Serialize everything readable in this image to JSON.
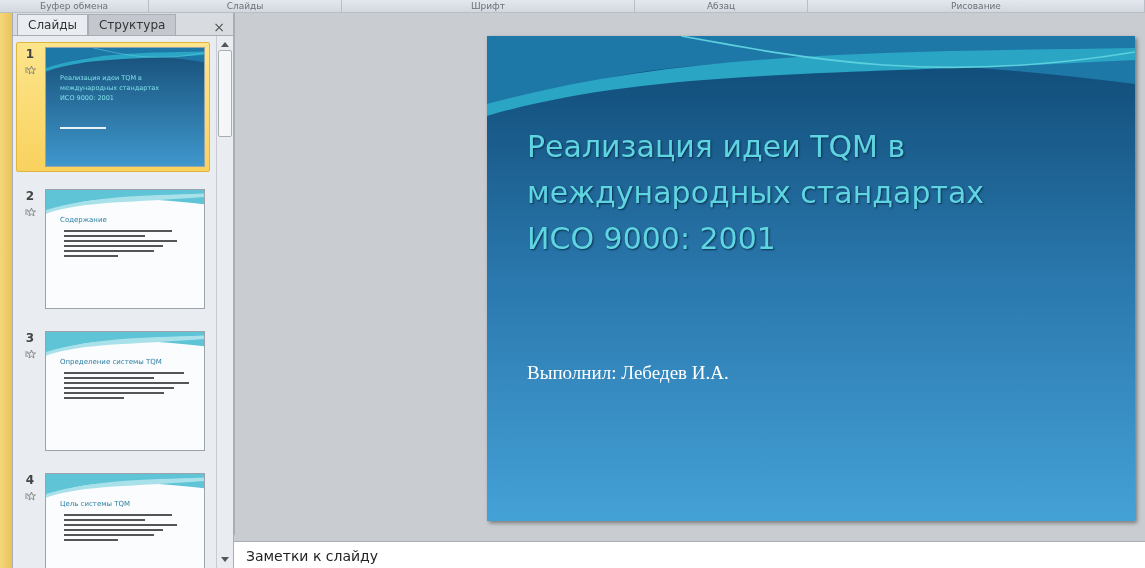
{
  "ribbon_groups": [
    "Буфер обмена",
    "Слайды",
    "Шрифт",
    "Абзац",
    "Рисование"
  ],
  "panel": {
    "tabs": [
      {
        "label": "Слайды",
        "selected": true
      },
      {
        "label": "Структура",
        "selected": false
      }
    ],
    "close": "×"
  },
  "slides": [
    {
      "number": "1",
      "kind": "title",
      "selected": true,
      "title": "Реализация идеи TQM в международных стандартах ИСО 9000: 2001"
    },
    {
      "number": "2",
      "kind": "content",
      "selected": false,
      "title": "Содержание"
    },
    {
      "number": "3",
      "kind": "content",
      "selected": false,
      "title": "Определение системы TQM"
    },
    {
      "number": "4",
      "kind": "content",
      "selected": false,
      "title": "Цель системы TQM"
    }
  ],
  "current_slide": {
    "title": "Реализация идеи TQM в международных стандартах ИСО 9000: 2001",
    "subtitle": "Выполнил: Лебедев И.А."
  },
  "notes": {
    "placeholder": "Заметки к слайду"
  }
}
